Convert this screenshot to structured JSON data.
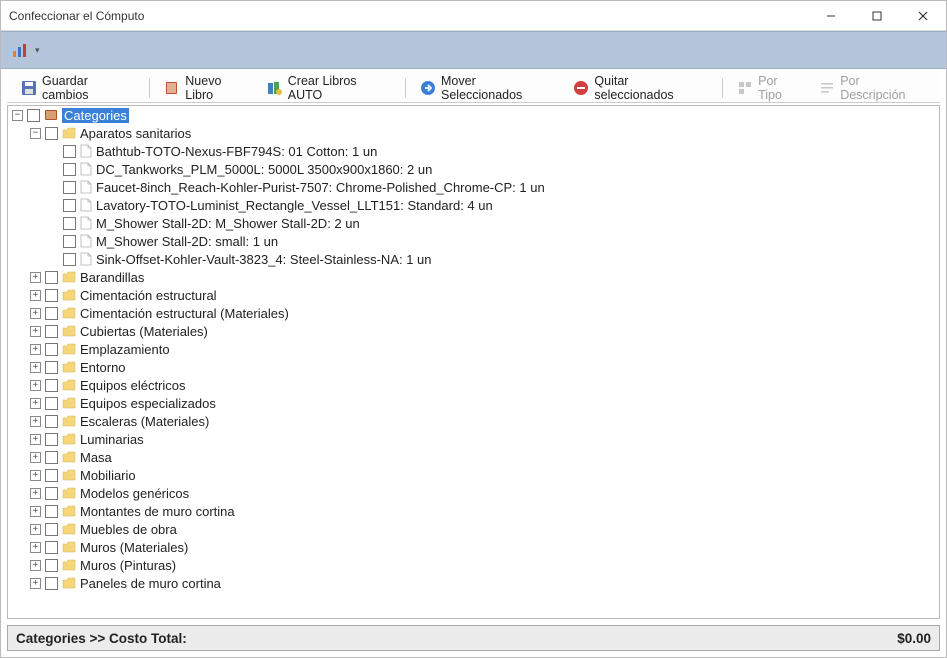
{
  "window": {
    "title": "Confeccionar el Cómputo"
  },
  "toolbar": {
    "guardar": "Guardar cambios",
    "nuevo": "Nuevo Libro",
    "crear": "Crear Libros AUTO",
    "mover": "Mover Seleccionados",
    "quitar": "Quitar seleccionados",
    "portipo": "Por Tipo",
    "pordesc": "Por Descripción"
  },
  "tree": {
    "root": "Categories",
    "expanded_branch": {
      "label": "Aparatos sanitarios",
      "items": [
        "Bathtub-TOTO-Nexus-FBF794S: 01 Cotton: 1 un",
        "DC_Tankworks_PLM_5000L: 5000L 3500x900x1860: 2 un",
        "Faucet-8inch_Reach-Kohler-Purist-7507: Chrome-Polished_Chrome-CP: 1 un",
        "Lavatory-TOTO-Luminist_Rectangle_Vessel_LLT151: Standard: 4 un",
        "M_Shower Stall-2D: M_Shower Stall-2D: 2 un",
        "M_Shower Stall-2D: small: 1 un",
        "Sink-Offset-Kohler-Vault-3823_4: Steel-Stainless-NA: 1 un"
      ]
    },
    "collapsed": [
      "Barandillas",
      "Cimentación estructural",
      "Cimentación estructural (Materiales)",
      "Cubiertas (Materiales)",
      "Emplazamiento",
      "Entorno",
      "Equipos eléctricos",
      "Equipos especializados",
      "Escaleras (Materiales)",
      "Luminarias",
      "Masa",
      "Mobiliario",
      "Modelos genéricos",
      "Montantes de muro cortina",
      "Muebles de obra",
      "Muros (Materiales)",
      "Muros (Pinturas)",
      "Paneles de muro cortina"
    ]
  },
  "status": {
    "label": "Categories >> Costo Total:",
    "value": "$0.00"
  }
}
